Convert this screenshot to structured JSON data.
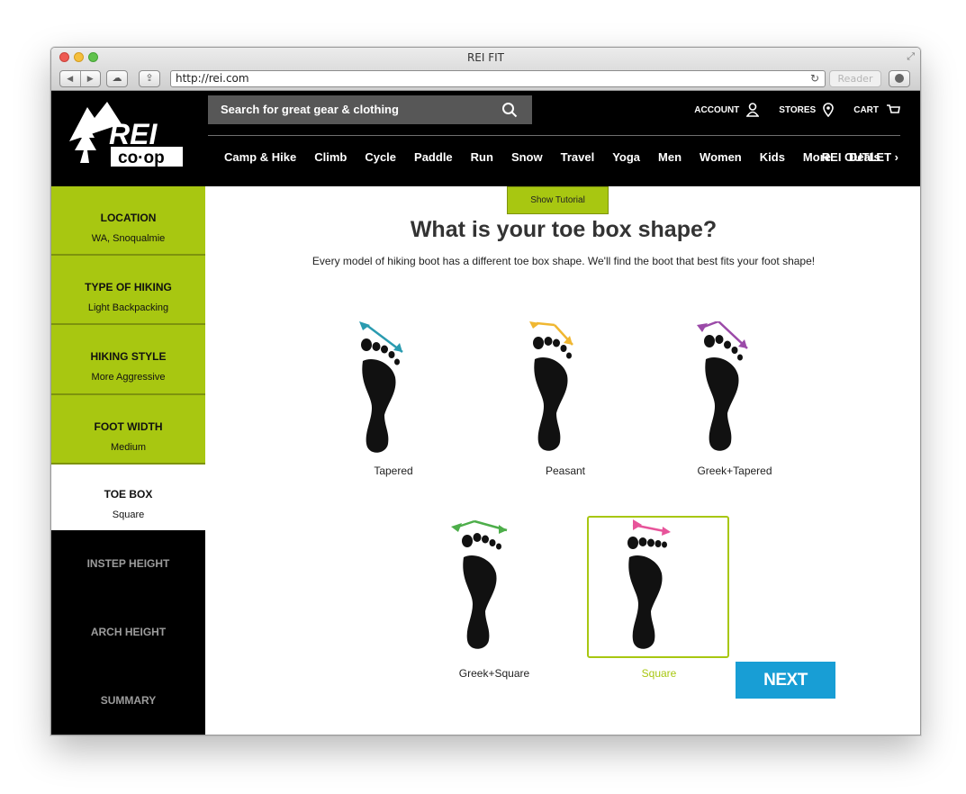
{
  "browser": {
    "window_title": "REI FIT",
    "url": "http://rei.com",
    "reader_label": "Reader"
  },
  "header": {
    "logo_text": "REI",
    "logo_sub": "co·op",
    "search_placeholder": "Search for great gear & clothing",
    "account_label": "ACCOUNT",
    "stores_label": "STORES",
    "cart_label": "CART",
    "nav_items": [
      "Camp & Hike",
      "Climb",
      "Cycle",
      "Paddle",
      "Run",
      "Snow",
      "Travel",
      "Yoga",
      "Men",
      "Women",
      "Kids",
      "More",
      "Deals"
    ],
    "outlet_label": "REI OUTLET"
  },
  "sidebar": {
    "steps": [
      {
        "label": "LOCATION",
        "value": "WA, Snoqualmie",
        "state": "done"
      },
      {
        "label": "TYPE OF HIKING",
        "value": "Light Backpacking",
        "state": "done"
      },
      {
        "label": "HIKING STYLE",
        "value": "More Aggressive",
        "state": "done"
      },
      {
        "label": "FOOT WIDTH",
        "value": "Medium",
        "state": "done"
      },
      {
        "label": "TOE BOX",
        "value": "Square",
        "state": "current"
      },
      {
        "label": "INSTEP HEIGHT",
        "value": "",
        "state": "pending"
      },
      {
        "label": "ARCH HEIGHT",
        "value": "",
        "state": "pending"
      },
      {
        "label": "SUMMARY",
        "value": "",
        "state": "pending"
      }
    ]
  },
  "main": {
    "tutorial_label": "Show Tutorial",
    "title": "What is your toe box shape?",
    "subtitle": "Every model of hiking boot has a different toe box shape. We'll find the boot that best fits your foot shape!",
    "options": [
      {
        "label": "Tapered",
        "arrow_color": "#2a9bb0",
        "selected": false
      },
      {
        "label": "Peasant",
        "arrow_color": "#f0b731",
        "selected": false
      },
      {
        "label": "Greek+Tapered",
        "arrow_color": "#9b4aa8",
        "selected": false
      },
      {
        "label": "Greek+Square",
        "arrow_color": "#4dae4a",
        "selected": false
      },
      {
        "label": "Square",
        "arrow_color": "#e7549a",
        "selected": true
      }
    ],
    "next_label": "NEXT"
  },
  "colors": {
    "accent_green": "#a8c711",
    "next_blue": "#189ed5"
  }
}
